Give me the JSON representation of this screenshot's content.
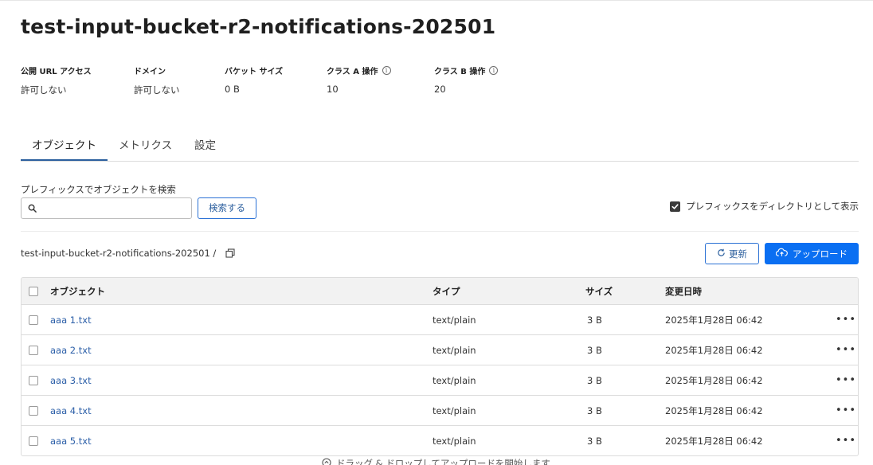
{
  "bucket": {
    "title": "test-input-bucket-r2-notifications-202501"
  },
  "stats": [
    {
      "label": "公開 URL アクセス",
      "value": "許可しない",
      "info": false
    },
    {
      "label": "ドメイン",
      "value": "許可しない",
      "info": false
    },
    {
      "label": "バケット サイズ",
      "value": "0 B",
      "info": false
    },
    {
      "label": "クラス A 操作",
      "value": "10",
      "info": true
    },
    {
      "label": "クラス B 操作",
      "value": "20",
      "info": true
    }
  ],
  "tabs": [
    {
      "label": "オブジェクト",
      "active": true
    },
    {
      "label": "メトリクス",
      "active": false
    },
    {
      "label": "設定",
      "active": false
    }
  ],
  "search": {
    "label": "プレフィックスでオブジェクトを検索",
    "value": "",
    "placeholder": "",
    "button_label": "検索する"
  },
  "directory_toggle": {
    "label": "プレフィックスをディレクトリとして表示",
    "checked": true
  },
  "breadcrumb": {
    "path": "test-input-bucket-r2-notifications-202501 /"
  },
  "actions": {
    "refresh_label": "更新",
    "upload_label": "アップロード"
  },
  "table": {
    "headers": {
      "object": "オブジェクト",
      "type": "タイプ",
      "size": "サイズ",
      "modified": "変更日時"
    },
    "rows": [
      {
        "name": "aaa 1.txt",
        "type": "text/plain",
        "size": "3 B",
        "modified": "2025年1月28日 06:42"
      },
      {
        "name": "aaa 2.txt",
        "type": "text/plain",
        "size": "3 B",
        "modified": "2025年1月28日 06:42"
      },
      {
        "name": "aaa 3.txt",
        "type": "text/plain",
        "size": "3 B",
        "modified": "2025年1月28日 06:42"
      },
      {
        "name": "aaa 4.txt",
        "type": "text/plain",
        "size": "3 B",
        "modified": "2025年1月28日 06:42"
      },
      {
        "name": "aaa 5.txt",
        "type": "text/plain",
        "size": "3 B",
        "modified": "2025年1月28日 06:42"
      }
    ]
  },
  "drop_hint": "ドラッグ & ドロップしてアップロードを開始します",
  "colors": {
    "accent": "#0a6ff2",
    "link": "#2c5fa8",
    "tab_underline": "#2c5f9e"
  },
  "icons": {
    "search": "search-icon",
    "refresh": "refresh-icon",
    "upload": "cloud-upload-icon",
    "copy": "copy-icon",
    "info": "info-icon",
    "more": "more-horizontal-icon"
  }
}
